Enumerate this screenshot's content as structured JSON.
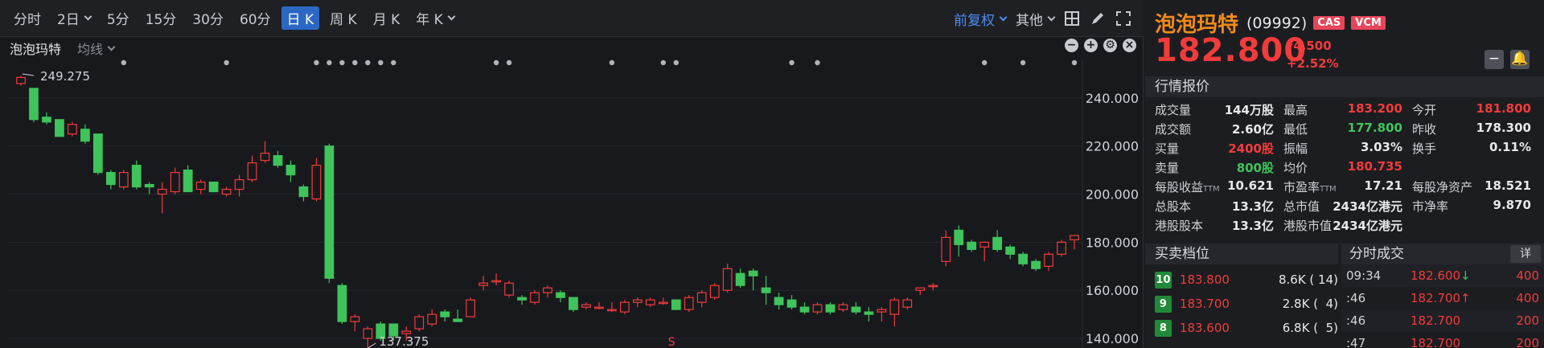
{
  "periods": [
    "分时",
    "2日",
    "5分",
    "15分",
    "30分",
    "60分",
    "日 K",
    "周 K",
    "月 K",
    "年 K"
  ],
  "active_period": "日 K",
  "toolbar": {
    "adjust": "前复权",
    "other": "其他"
  },
  "indicator": {
    "name": "泡泡玛特",
    "ma": "均线"
  },
  "chart_data": {
    "type": "candlestick",
    "y_ticks": [
      240,
      220,
      200,
      180,
      160,
      140
    ],
    "ylim": [
      136,
      256
    ],
    "tick_labels": [
      "240.000",
      "220.000",
      "200.000",
      "180.000",
      "160.000",
      "140.000"
    ],
    "high_label": "249.275",
    "low_label": "137.375",
    "marker_label": "S",
    "candles": [
      [
        246,
        249.3,
        245,
        248.5
      ],
      [
        244,
        244,
        230,
        231
      ],
      [
        232,
        234,
        229,
        230
      ],
      [
        231,
        231,
        224,
        224
      ],
      [
        225,
        230,
        224,
        229
      ],
      [
        227,
        229,
        221,
        222
      ],
      [
        225,
        225,
        208,
        209
      ],
      [
        209,
        210,
        202,
        204
      ],
      [
        203,
        210,
        202,
        209
      ],
      [
        212,
        214,
        202,
        203
      ],
      [
        204,
        205,
        200,
        203
      ],
      [
        200,
        205,
        192,
        202
      ],
      [
        201,
        211,
        200,
        209
      ],
      [
        210,
        212,
        201,
        201
      ],
      [
        202,
        206,
        200,
        205
      ],
      [
        205,
        205,
        201,
        201
      ],
      [
        200,
        203,
        199,
        202
      ],
      [
        202,
        208,
        199,
        206
      ],
      [
        206,
        216,
        205,
        213
      ],
      [
        214,
        222,
        213,
        217
      ],
      [
        216,
        218,
        211,
        212
      ],
      [
        212,
        214,
        205,
        208
      ],
      [
        203,
        204,
        197,
        199
      ],
      [
        198,
        215,
        197,
        212
      ],
      [
        220,
        221,
        163,
        165
      ],
      [
        162,
        163,
        146,
        147
      ],
      [
        147,
        150,
        143,
        149
      ],
      [
        140,
        145,
        136,
        144
      ],
      [
        146,
        147,
        139,
        140
      ],
      [
        146,
        146,
        139,
        141
      ],
      [
        142,
        145,
        139,
        143
      ],
      [
        144,
        150,
        143,
        149
      ],
      [
        146,
        152,
        145,
        150
      ],
      [
        151,
        152,
        147,
        149
      ],
      [
        148,
        152,
        147,
        147
      ],
      [
        149,
        157,
        149,
        156
      ],
      [
        162,
        166,
        160,
        163
      ],
      [
        164,
        167,
        162,
        164
      ],
      [
        158,
        164,
        157,
        163
      ],
      [
        157,
        158,
        154,
        156
      ],
      [
        155,
        160,
        154,
        159
      ],
      [
        159,
        162,
        157,
        161
      ],
      [
        159,
        160,
        155,
        157
      ],
      [
        157,
        157,
        151,
        152
      ],
      [
        153,
        155,
        152,
        154
      ],
      [
        153,
        155,
        152,
        153
      ],
      [
        152,
        155,
        151,
        152
      ],
      [
        151,
        156,
        150,
        155
      ],
      [
        155,
        157,
        153,
        156
      ],
      [
        154,
        157,
        153,
        156
      ],
      [
        155,
        157,
        154,
        155
      ],
      [
        156,
        156,
        152,
        152
      ],
      [
        152,
        158,
        151,
        157
      ],
      [
        155,
        160,
        153,
        159
      ],
      [
        157,
        163,
        156,
        162
      ],
      [
        160,
        171,
        159,
        169
      ],
      [
        167,
        169,
        161,
        162
      ],
      [
        168,
        169,
        160,
        166
      ],
      [
        161,
        166,
        154,
        159
      ],
      [
        157,
        159,
        152,
        154
      ],
      [
        156,
        158,
        152,
        153
      ],
      [
        153,
        155,
        150,
        151
      ],
      [
        151,
        155,
        150,
        154
      ],
      [
        154,
        155,
        150,
        151
      ],
      [
        152,
        155,
        151,
        154
      ],
      [
        153,
        155,
        150,
        151
      ],
      [
        151,
        153,
        147,
        150
      ],
      [
        151,
        153,
        147,
        152
      ],
      [
        150,
        157,
        145,
        156
      ],
      [
        153,
        157,
        152,
        156
      ],
      [
        160,
        161,
        158,
        161
      ],
      [
        162,
        163,
        160,
        162
      ],
      [
        172,
        185,
        170,
        182
      ],
      [
        185,
        187,
        174,
        179
      ],
      [
        180,
        181,
        176,
        177
      ],
      [
        178,
        180,
        172,
        180
      ],
      [
        182,
        185,
        176,
        177
      ],
      [
        178,
        179,
        173,
        175
      ],
      [
        175,
        176,
        170,
        171
      ],
      [
        172,
        173,
        168,
        169
      ],
      [
        170,
        176,
        168,
        175
      ],
      [
        175,
        181,
        174,
        180
      ],
      [
        181,
        183,
        177,
        182.8
      ]
    ],
    "dots": [
      8,
      16,
      23,
      24,
      25,
      26,
      27,
      28,
      29,
      37,
      38,
      46,
      50,
      51,
      60,
      62,
      75,
      78,
      82
    ]
  },
  "quote": {
    "name": "泡泡玛特",
    "code": "(09992)",
    "tags": [
      "CAS",
      "VCM"
    ],
    "price": "182.800",
    "change": "4.500",
    "pct": "+2.52%",
    "section": "行情报价",
    "grid": [
      [
        [
          "成交量",
          "144万股",
          ""
        ],
        [
          "最高",
          "183.200",
          "red"
        ],
        [
          "今开",
          "181.800",
          "red"
        ]
      ],
      [
        [
          "成交额",
          "2.60亿",
          ""
        ],
        [
          "最低",
          "177.800",
          "green"
        ],
        [
          "昨收",
          "178.300",
          ""
        ]
      ],
      [
        [
          "买量",
          "2400股",
          "red"
        ],
        [
          "振幅",
          "3.03%",
          ""
        ],
        [
          "换手",
          "0.11%",
          ""
        ]
      ],
      [
        [
          "卖量",
          "800股",
          "green"
        ],
        [
          "均价",
          "180.735",
          "red"
        ],
        [
          "",
          "",
          ""
        ]
      ],
      [
        [
          "每股收益",
          "10.621",
          "",
          "TTM"
        ],
        [
          "市盈率",
          "17.21",
          "",
          "TTM"
        ],
        [
          "每股净资产",
          "18.521",
          ""
        ]
      ],
      [
        [
          "总股本",
          "13.3亿",
          ""
        ],
        [
          "总市值",
          "2434亿港元",
          ""
        ],
        [
          "市净率",
          "9.870",
          ""
        ]
      ],
      [
        [
          "港股股本",
          "13.3亿",
          ""
        ],
        [
          "港股市值",
          "2434亿港元",
          ""
        ],
        [
          "",
          "",
          ""
        ]
      ]
    ],
    "order_book_title": "买卖档位",
    "order_book": [
      {
        "level": "10",
        "price": "183.800",
        "vol": "8.6K ( 14)"
      },
      {
        "level": "9",
        "price": "183.700",
        "vol": "2.8K (  4)"
      },
      {
        "level": "8",
        "price": "183.600",
        "vol": "6.8K (  5)"
      }
    ],
    "trades_title": "分时成交",
    "trades_detail": "详",
    "trades": [
      {
        "time": "09:34",
        "price": "182.600",
        "arrow": "down",
        "vol": "400"
      },
      {
        "time": ":46",
        "price": "182.700",
        "arrow": "up",
        "vol": "400"
      },
      {
        "time": ":46",
        "price": "182.700",
        "arrow": "",
        "vol": "200"
      },
      {
        "time": ":47",
        "price": "182.700",
        "arrow": "",
        "vol": "200"
      }
    ]
  },
  "colors": {
    "up": "#f23b3b",
    "down": "#3ec45b",
    "accent": "#2b68c4",
    "name": "#f08b1a"
  }
}
